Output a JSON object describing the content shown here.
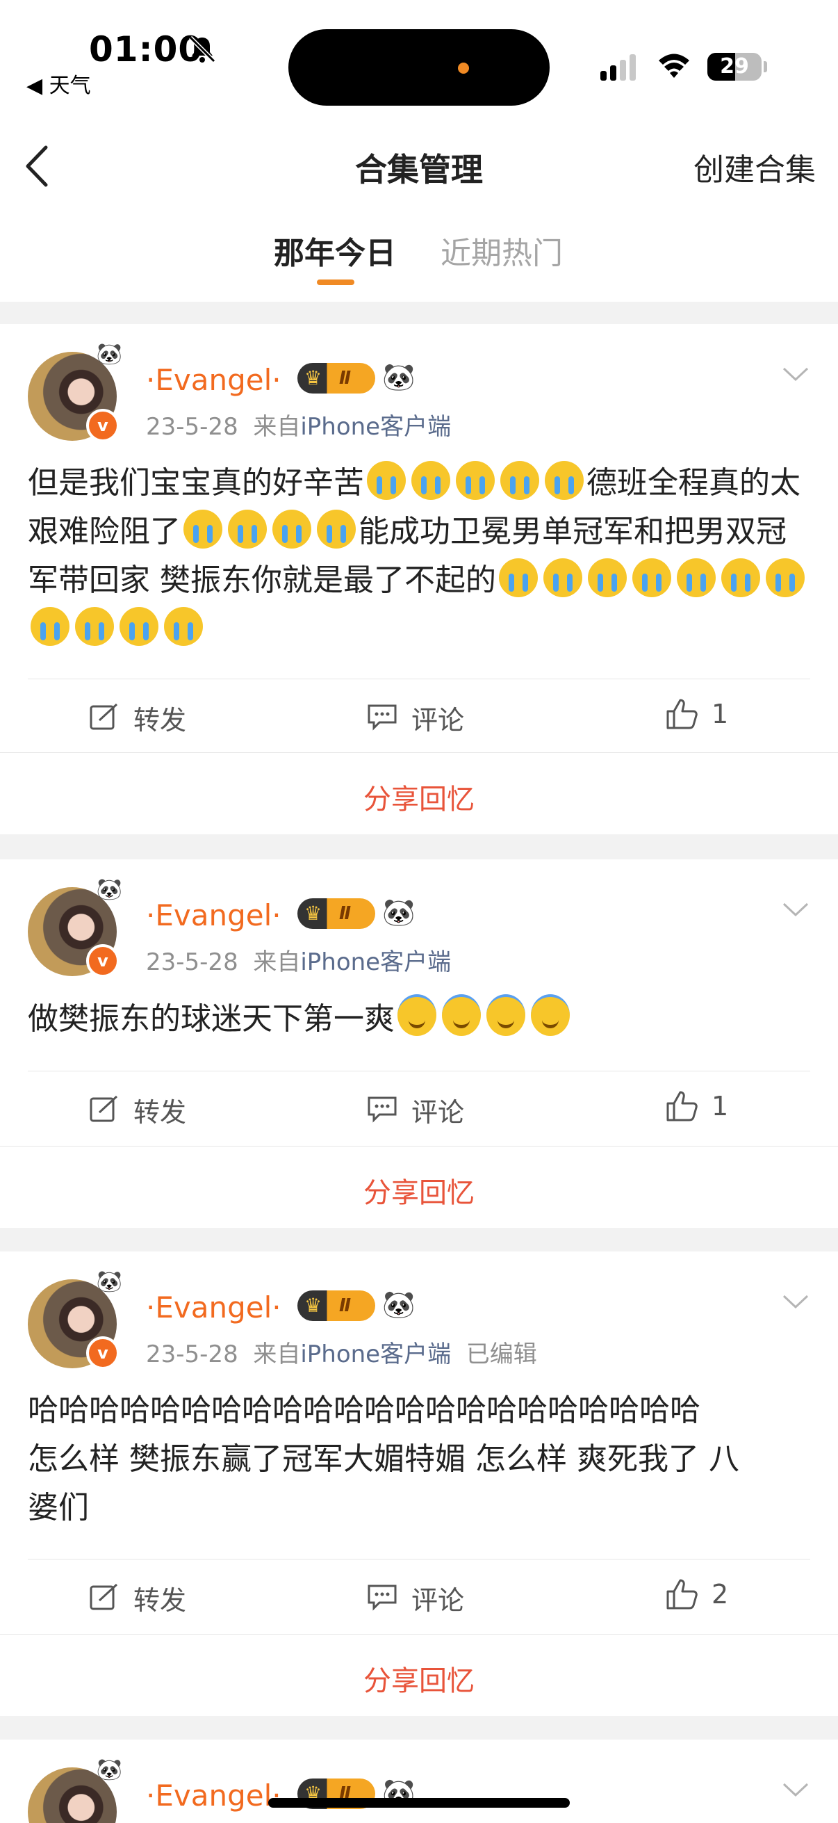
{
  "status": {
    "time": "01:00",
    "back_app": "◀ 天气",
    "battery": "29"
  },
  "nav": {
    "title": "合集管理",
    "create": "创建合集"
  },
  "tabs": [
    {
      "label": "那年今日"
    },
    {
      "label": "近期热门"
    }
  ],
  "colors": {
    "accent": "#f26a1f",
    "share": "#e8543a",
    "tab_indicator": "#f08a24"
  },
  "posts": [
    {
      "username": "·Evangel·",
      "level": "Ⅱ",
      "date": "23-5-28",
      "source_prefix": "来自",
      "source": "iPhone客户端",
      "edited": "",
      "content_lines": [
        "但是我们宝宝真的好辛苦",
        "德班全程真的太艰难险阻了",
        "能成功卫冕男单冠军和把男双冠军带回家 樊振东你就是最了不起的"
      ],
      "repost": "转发",
      "comment": "评论",
      "likes": "1",
      "share": "分享回忆"
    },
    {
      "username": "·Evangel·",
      "level": "Ⅱ",
      "date": "23-5-28",
      "source_prefix": "来自",
      "source": "iPhone客户端",
      "edited": "",
      "content_lines": [
        "做樊振东的球迷天下第一爽"
      ],
      "repost": "转发",
      "comment": "评论",
      "likes": "1",
      "share": "分享回忆"
    },
    {
      "username": "·Evangel·",
      "level": "Ⅱ",
      "date": "23-5-28",
      "source_prefix": "来自",
      "source": "iPhone客户端",
      "edited": "已编辑",
      "content_lines": [
        "哈哈哈哈哈哈哈哈哈哈哈哈哈哈哈哈哈哈哈哈哈哈",
        "怎么样 樊振东赢了冠军大媚特媚 怎么样 爽死我了 八",
        "婆们"
      ],
      "repost": "转发",
      "comment": "评论",
      "likes": "2",
      "share": "分享回忆"
    },
    {
      "username": "·Evangel·",
      "level": "Ⅱ"
    }
  ]
}
